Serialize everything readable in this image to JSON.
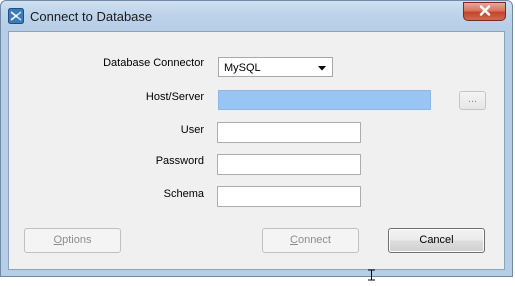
{
  "window": {
    "title": "Connect to Database",
    "app_icon": "database-app-icon",
    "close_icon": "close-icon"
  },
  "form": {
    "connector": {
      "label": "Database Connector",
      "value": "MySQL",
      "arrow_icon": "dropdown-arrow-icon"
    },
    "host": {
      "label": "Host/Server",
      "value": "",
      "browse_label": "..."
    },
    "user": {
      "label": "User",
      "value": ""
    },
    "password": {
      "label": "Password",
      "value": ""
    },
    "schema": {
      "label": "Schema",
      "value": ""
    }
  },
  "buttons": {
    "options_prefix": "O",
    "options_rest": "ptions",
    "connect_prefix": "C",
    "connect_rest": "onnect",
    "cancel": "Cancel"
  },
  "colors": {
    "host_selected_bg": "#99c5f5",
    "close_button": "#c2452c",
    "disabled_text": "#8d8d8d"
  }
}
